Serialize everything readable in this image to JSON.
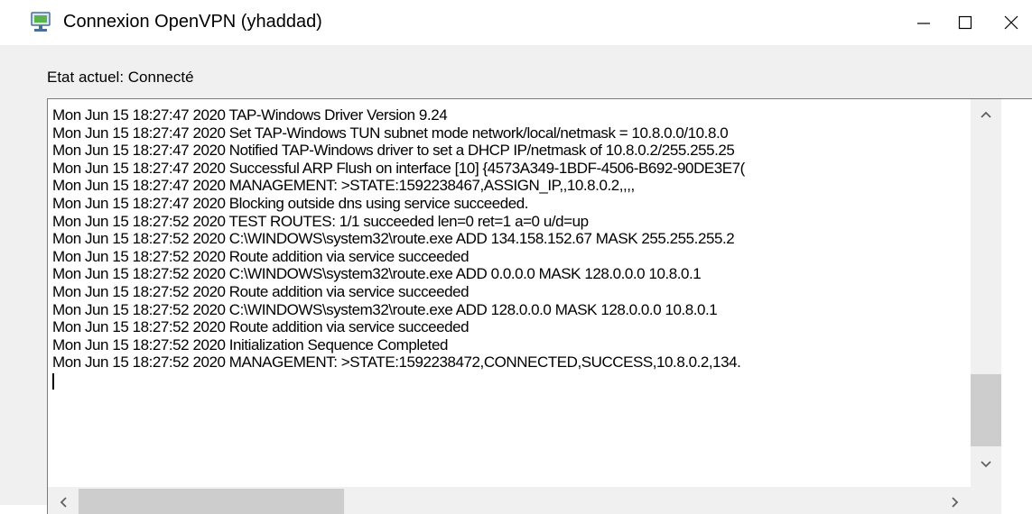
{
  "window": {
    "title": "Connexion OpenVPN (yhaddad)",
    "icon": "openvpn-monitor-icon",
    "controls": {
      "minimize": "minimize-icon",
      "maximize": "maximize-icon",
      "close": "close-icon"
    }
  },
  "status": {
    "label": "Etat actuel: Connecté"
  },
  "log": {
    "lines": [
      "Mon Jun 15 18:27:47 2020 TAP-Windows Driver Version 9.24",
      "Mon Jun 15 18:27:47 2020 Set TAP-Windows TUN subnet mode network/local/netmask = 10.8.0.0/10.8.0",
      "Mon Jun 15 18:27:47 2020 Notified TAP-Windows driver to set a DHCP IP/netmask of 10.8.0.2/255.255.25",
      "Mon Jun 15 18:27:47 2020 Successful ARP Flush on interface [10] {4573A349-1BDF-4506-B692-90DE3E7(",
      "Mon Jun 15 18:27:47 2020 MANAGEMENT: >STATE:1592238467,ASSIGN_IP,,10.8.0.2,,,,",
      "Mon Jun 15 18:27:47 2020 Blocking outside dns using service succeeded.",
      "Mon Jun 15 18:27:52 2020 TEST ROUTES: 1/1 succeeded len=0 ret=1 a=0 u/d=up",
      "Mon Jun 15 18:27:52 2020 C:\\WINDOWS\\system32\\route.exe ADD 134.158.152.67 MASK 255.255.255.2",
      "Mon Jun 15 18:27:52 2020 Route addition via service succeeded",
      "Mon Jun 15 18:27:52 2020 C:\\WINDOWS\\system32\\route.exe ADD 0.0.0.0 MASK 128.0.0.0 10.8.0.1",
      "Mon Jun 15 18:27:52 2020 Route addition via service succeeded",
      "Mon Jun 15 18:27:52 2020 C:\\WINDOWS\\system32\\route.exe ADD 128.0.0.0 MASK 128.0.0.0 10.8.0.1",
      "Mon Jun 15 18:27:52 2020 Route addition via service succeeded",
      "Mon Jun 15 18:27:52 2020 Initialization Sequence Completed",
      "Mon Jun 15 18:27:52 2020 MANAGEMENT: >STATE:1592238472,CONNECTED,SUCCESS,10.8.0.2,134."
    ]
  },
  "scrollbars": {
    "vertical": {
      "up": "chevron-up-icon",
      "down": "chevron-down-icon"
    },
    "horizontal": {
      "left": "chevron-left-icon",
      "right": "chevron-right-icon"
    }
  }
}
